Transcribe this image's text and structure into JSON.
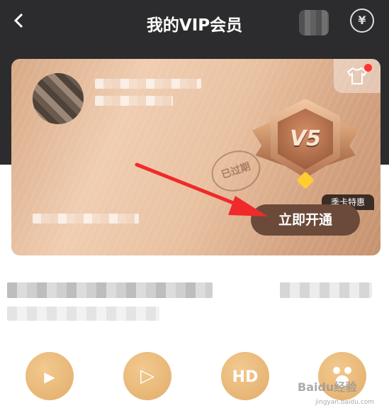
{
  "header": {
    "back_icon": "chevron-left-icon",
    "title": "我的VIP会员",
    "exchange_icon": "yuan-refresh-icon",
    "exchange_glyph": "¥"
  },
  "card": {
    "shirt_icon": "t-shirt-icon",
    "expired_stamp": "已过期",
    "badge_level": "V5",
    "season_tag": "季卡特惠",
    "open_button": "立即开通"
  },
  "features": [
    {
      "icon": "flame-play-icon",
      "glyph": "▶"
    },
    {
      "icon": "film-play-icon",
      "glyph": "▷"
    },
    {
      "icon": "hd-icon",
      "glyph": "HD"
    },
    {
      "icon": "paw-icon",
      "glyph": ""
    }
  ],
  "watermark": {
    "text": "Baidu经验",
    "sub": "jingyan.baidu.com"
  },
  "colors": {
    "header_bg": "#2c2c2e",
    "open_button_bg": "#6b4a39",
    "annotation_arrow": "#f02a2a",
    "feature_icon": "#e8b878"
  }
}
